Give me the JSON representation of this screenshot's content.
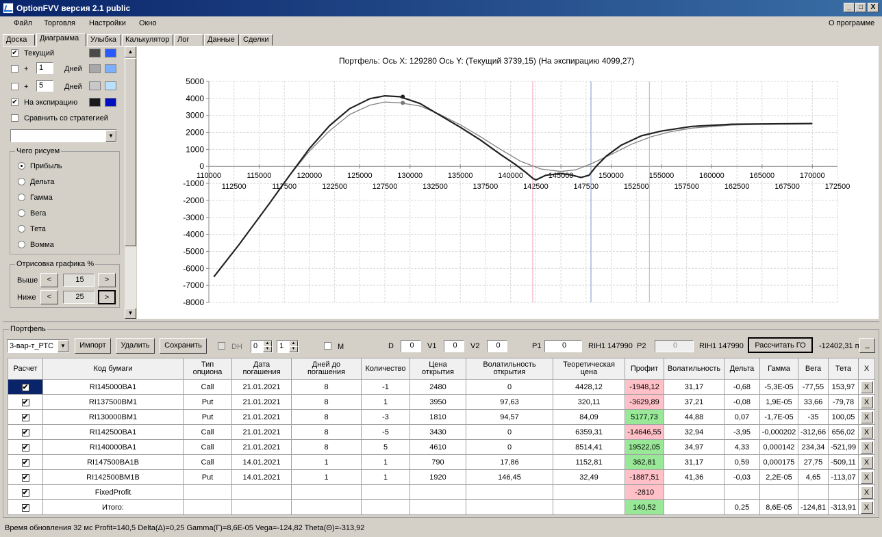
{
  "window": {
    "title": "OptionFVV версия 2.1 public",
    "min": "_",
    "max": "□",
    "close": "X"
  },
  "menu": {
    "file": "Файл",
    "trade": "Торговля",
    "settings": "Настройки",
    "window": "Окно",
    "about": "О программе"
  },
  "tabs": [
    "Доска",
    "Диаграмма",
    "Улыбка",
    "Калькулятор",
    "Лог",
    "Данные",
    "Сделки"
  ],
  "left": {
    "current": "Текущий",
    "plus1": "+",
    "days1": "1",
    "days_label1": "Дней",
    "plus2": "+",
    "days2": "5",
    "days_label2": "Дней",
    "expiry": "На экспирацию",
    "compare": "Сравнить со стратегией",
    "what_group": "Чего рисуем",
    "radios": [
      "Прибыль",
      "Дельта",
      "Гамма",
      "Вега",
      "Тета",
      "Вомма"
    ],
    "draw_group": "Отрисовка графика %",
    "above": "Выше",
    "above_val": "15",
    "below": "Ниже",
    "below_val": "25",
    "left_arrow": "<",
    "right_arrow": ">"
  },
  "chart_header": "Портфель: Ось X: 129280 Ось Y:  (Текущий 3739,15)  (На экспирацию 4099,27)",
  "chart_data": {
    "type": "line",
    "y_ticks": [
      "5000",
      "4000",
      "3000",
      "2000",
      "1000",
      "0",
      "-1000",
      "-2000",
      "-3000",
      "-4000",
      "-5000",
      "-6000",
      "-7000",
      "-8000"
    ],
    "x_ticks_top": [
      "110000",
      "115000",
      "120000",
      "125000",
      "130000",
      "135000",
      "140000",
      "145000",
      "150000",
      "155000",
      "160000",
      "165000",
      "170000"
    ],
    "x_ticks_bottom": [
      "112500",
      "117500",
      "122500",
      "127500",
      "132500",
      "137500",
      "142500",
      "147500",
      "152500",
      "157500",
      "162500",
      "167500",
      "172500"
    ],
    "ylim": [
      -8000,
      5000
    ],
    "xlim": [
      110000,
      172500
    ],
    "series": [
      {
        "color": "#222222",
        "x": [
          110500,
          113000,
          116000,
          118000,
          120000,
          122000,
          124000,
          126000,
          127500,
          129000,
          131000,
          133000,
          135000,
          137000,
          139000,
          140500,
          141500,
          142200,
          142500,
          143500,
          145000,
          146000,
          147000,
          147800,
          148500,
          149500,
          151000,
          153000,
          155000,
          158000,
          162000,
          166000,
          170000
        ],
        "y": [
          -6500,
          -4600,
          -2200,
          -550,
          1050,
          2400,
          3400,
          3980,
          4150,
          4099,
          3700,
          3000,
          2300,
          1550,
          700,
          100,
          -350,
          -700,
          -800,
          -520,
          -420,
          -500,
          -650,
          -520,
          0,
          600,
          1250,
          1800,
          2080,
          2350,
          2480,
          2500,
          2520
        ]
      },
      {
        "color": "#808080",
        "x": [
          110500,
          113000,
          116000,
          118000,
          120000,
          122000,
          124000,
          126000,
          127500,
          129000,
          131000,
          133000,
          135000,
          137000,
          139000,
          141000,
          143000,
          145000,
          146500,
          148000,
          150000,
          152000,
          154000,
          156000,
          158000,
          162000,
          166000,
          170000
        ],
        "y": [
          -6500,
          -4600,
          -2200,
          -550,
          900,
          2100,
          3050,
          3600,
          3790,
          3739,
          3550,
          3050,
          2450,
          1750,
          1000,
          300,
          -150,
          -300,
          -200,
          150,
          700,
          1300,
          1750,
          2050,
          2250,
          2430,
          2490,
          2520
        ]
      }
    ]
  },
  "portfolio": {
    "group": "Портфель",
    "select": "3-вар-т_РТС",
    "import": "Импорт",
    "delete": "Удалить",
    "save": "Сохранить",
    "dh": "DH",
    "dh_v1": "0",
    "dh_v2": "1",
    "m": "M",
    "d": "D",
    "d_val": "0",
    "v1": "V1",
    "v1_val": "0",
    "v2": "V2",
    "v2_val": "0",
    "p1": "P1",
    "p1_val": "0",
    "p1_label": "RIH1 147990",
    "p2": "P2",
    "p2_val": "0",
    "p2_label": "RIH1 147990",
    "calc": "Рассчитать ГО",
    "go_val": "-12402,31 п",
    "go_btn": "_"
  },
  "table": {
    "headers": [
      "Расчет",
      "Код бумаги",
      "Тип\nопциона",
      "Дата\nпогашения",
      "Дней до\nпогашения",
      "Количество",
      "Цена\nоткрытия",
      "Волатильность\nоткрытия",
      "Теоретическая\nцена",
      "Профит",
      "Волатильность",
      "Дельта",
      "Гамма",
      "Вега",
      "Тета",
      "X"
    ],
    "rows": [
      [
        "RI145000BA1",
        "Call",
        "21.01.2021",
        "8",
        "-1",
        "2480",
        "0",
        "4428,12",
        "-1948,12",
        "31,17",
        "-0,68",
        "-5,3E-05",
        "-77,55",
        "153,97"
      ],
      [
        "RI137500BM1",
        "Put",
        "21.01.2021",
        "8",
        "1",
        "3950",
        "97,63",
        "320,11",
        "-3629,89",
        "37,21",
        "-0,08",
        "1,9E-05",
        "33,66",
        "-79,78"
      ],
      [
        "RI130000BM1",
        "Put",
        "21.01.2021",
        "8",
        "-3",
        "1810",
        "94,57",
        "84,09",
        "5177,73",
        "44,88",
        "0,07",
        "-1,7E-05",
        "-35",
        "100,05"
      ],
      [
        "RI142500BA1",
        "Call",
        "21.01.2021",
        "8",
        "-5",
        "3430",
        "0",
        "6359,31",
        "-14646,55",
        "32,94",
        "-3,95",
        "-0,000202",
        "-312,66",
        "656,02"
      ],
      [
        "RI140000BA1",
        "Call",
        "21.01.2021",
        "8",
        "5",
        "4610",
        "0",
        "8514,41",
        "19522,05",
        "34,97",
        "4,33",
        "0,000142",
        "234,34",
        "-521,99"
      ],
      [
        "RI147500BA1B",
        "Call",
        "14.01.2021",
        "1",
        "1",
        "790",
        "17,86",
        "1152,81",
        "362,81",
        "31,17",
        "0,59",
        "0,000175",
        "27,75",
        "-509,11"
      ],
      [
        "RI142500BM1B",
        "Put",
        "14.01.2021",
        "1",
        "1",
        "1920",
        "146,45",
        "32,49",
        "-1887,51",
        "41,36",
        "-0,03",
        "2,2E-05",
        "4,65",
        "-113,07"
      ],
      [
        "FixedProfit",
        "",
        "",
        "",
        "",
        "",
        "",
        "",
        "-2810",
        "",
        "",
        "",
        "",
        ""
      ],
      [
        "Итого:",
        "",
        "",
        "",
        "",
        "",
        "",
        "",
        "140,52",
        "",
        "0,25",
        "8,6E-05",
        "-124,81",
        "-313,91"
      ]
    ],
    "check": "✔",
    "x": "X"
  },
  "status": "Время обновления 32 мс  Profit=140,5 Delta(Δ)=0,25 Gamma(Γ)=8,6E-05 Vega=-124,82 Theta(Θ)=-313,92"
}
